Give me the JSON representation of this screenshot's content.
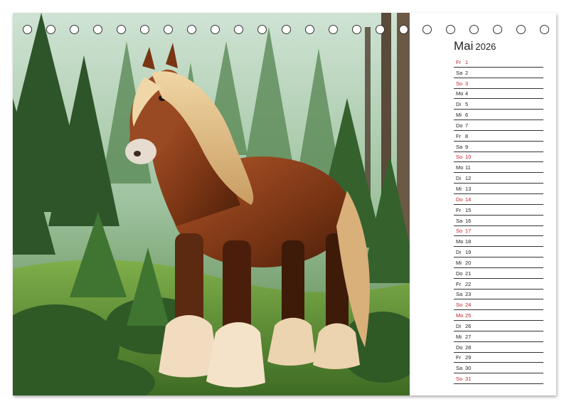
{
  "calendar": {
    "month": "Mai",
    "year": "2026",
    "days": [
      {
        "wd": "Fr",
        "d": "1",
        "red": true
      },
      {
        "wd": "Sa",
        "d": "2",
        "red": false
      },
      {
        "wd": "So",
        "d": "3",
        "red": true
      },
      {
        "wd": "Mo",
        "d": "4",
        "red": false
      },
      {
        "wd": "Di",
        "d": "5",
        "red": false
      },
      {
        "wd": "Mi",
        "d": "6",
        "red": false
      },
      {
        "wd": "Do",
        "d": "7",
        "red": false
      },
      {
        "wd": "Fr",
        "d": "8",
        "red": false
      },
      {
        "wd": "Sa",
        "d": "9",
        "red": false
      },
      {
        "wd": "So",
        "d": "10",
        "red": true
      },
      {
        "wd": "Mo",
        "d": "11",
        "red": false
      },
      {
        "wd": "Di",
        "d": "12",
        "red": false
      },
      {
        "wd": "Mi",
        "d": "13",
        "red": false
      },
      {
        "wd": "Do",
        "d": "14",
        "red": true
      },
      {
        "wd": "Fr",
        "d": "15",
        "red": false
      },
      {
        "wd": "Sa",
        "d": "16",
        "red": false
      },
      {
        "wd": "So",
        "d": "17",
        "red": true
      },
      {
        "wd": "Mo",
        "d": "18",
        "red": false
      },
      {
        "wd": "Di",
        "d": "19",
        "red": false
      },
      {
        "wd": "Mi",
        "d": "20",
        "red": false
      },
      {
        "wd": "Do",
        "d": "21",
        "red": false
      },
      {
        "wd": "Fr",
        "d": "22",
        "red": false
      },
      {
        "wd": "Sa",
        "d": "23",
        "red": false
      },
      {
        "wd": "So",
        "d": "24",
        "red": true
      },
      {
        "wd": "Mo",
        "d": "25",
        "red": true
      },
      {
        "wd": "Di",
        "d": "26",
        "red": false
      },
      {
        "wd": "Mi",
        "d": "27",
        "red": false
      },
      {
        "wd": "Do",
        "d": "28",
        "red": false
      },
      {
        "wd": "Fr",
        "d": "29",
        "red": false
      },
      {
        "wd": "Sa",
        "d": "30",
        "red": false
      },
      {
        "wd": "So",
        "d": "31",
        "red": true
      }
    ],
    "colors": {
      "holiday": "#c0202a",
      "text": "#222222",
      "rule": "#333333"
    }
  },
  "photo": {
    "subject": "chestnut-horse-in-forest-illustration"
  }
}
